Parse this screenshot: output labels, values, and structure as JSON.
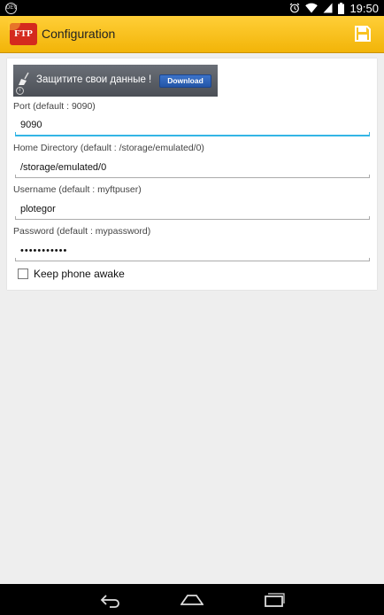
{
  "status_bar": {
    "left_icon": "debug-icon",
    "left_icon_text": "DEV",
    "icons": [
      "alarm-icon",
      "wifi-icon",
      "signal-icon",
      "battery-icon"
    ],
    "time": "19:50"
  },
  "action_bar": {
    "logo_text": "FTP",
    "title": "Configuration",
    "save_icon": "save-icon"
  },
  "ad": {
    "icon": "broom-icon",
    "text": "Защитите свои данные !",
    "button_label": "Download",
    "info_icon": "info-icon",
    "info_text": "i"
  },
  "form": {
    "port": {
      "label": "Port (default : 9090)",
      "value": "9090"
    },
    "home_directory": {
      "label": "Home Directory (default : /storage/emulated/0)",
      "value": "/storage/emulated/0"
    },
    "username": {
      "label": "Username (default : myftpuser)",
      "value": "plotegor"
    },
    "password": {
      "label": "Password (default : mypassword)",
      "value": "•••••••••••"
    },
    "keep_awake": {
      "label": "Keep phone awake",
      "checked": false
    }
  },
  "nav_bar": {
    "icons": [
      "back-icon",
      "home-icon",
      "recents-icon"
    ]
  },
  "colors": {
    "action_bar": "#f7c21c",
    "focus_accent": "#33b5e5",
    "logo_red": "#d42a1e",
    "ad_button": "#2f62b8"
  }
}
